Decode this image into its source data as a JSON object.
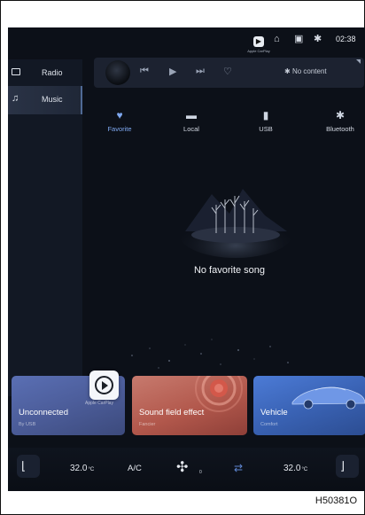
{
  "status_bar": {
    "carplay_caption": "Apple CarPlay",
    "time": "02:38",
    "icons": [
      "carplay-icon",
      "usb-icon",
      "screen-icon",
      "bluetooth-icon"
    ]
  },
  "sidebar": {
    "items": [
      {
        "label": "Radio",
        "icon": "radio-icon"
      },
      {
        "label": "Music",
        "icon": "music-note-icon",
        "active": true
      }
    ]
  },
  "player": {
    "status": "No content",
    "controls": [
      "previous-icon",
      "play-icon",
      "next-icon",
      "heart-icon"
    ]
  },
  "tabs": [
    {
      "label": "Favorite",
      "icon": "heart-icon",
      "active": true
    },
    {
      "label": "Local",
      "icon": "folder-icon"
    },
    {
      "label": "USB",
      "icon": "usb-icon"
    },
    {
      "label": "Bluetooth",
      "icon": "bluetooth-icon"
    }
  ],
  "empty_state": {
    "message": "No favorite song"
  },
  "cards": [
    {
      "title": "Unconnected",
      "subtitle": "By USB",
      "carplay_caption": "Apple CarPlay"
    },
    {
      "title": "Sound field effect",
      "subtitle": "Fancier"
    },
    {
      "title": "Vehicle",
      "subtitle": "Comfort"
    }
  ],
  "climate": {
    "left_temp": "32.0",
    "right_temp": "32.0",
    "unit": "°C",
    "ac_label": "A/C",
    "fan_level": "0"
  },
  "reference_code": "H50381O",
  "colors": {
    "screen_bg": "#0c1018",
    "accent": "#7fa8f0",
    "card_carplay": "#5a6fb4",
    "card_sound": "#c77a6e",
    "card_vehicle": "#4c7bd6"
  }
}
